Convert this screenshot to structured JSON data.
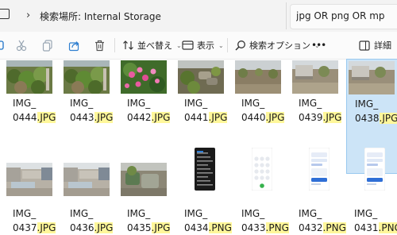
{
  "address_bar": {
    "path": "検索場所: Internal Storage",
    "search_value": "jpg OR png OR mp"
  },
  "toolbar": {
    "sort_label": "並べ替え",
    "view_label": "表示",
    "search_options_label": "検索オプション",
    "more_label": "•••",
    "details_label": "詳細"
  },
  "files": [
    {
      "prefix": "IMG_",
      "number": "0444",
      "ext": ".JPG",
      "thumb": "garden-plants"
    },
    {
      "prefix": "IMG_",
      "number": "0443",
      "ext": ".JPG",
      "thumb": "garden-plants"
    },
    {
      "prefix": "IMG_",
      "number": "0442",
      "ext": ".JPG",
      "thumb": "pink-flowers"
    },
    {
      "prefix": "IMG_",
      "number": "0441",
      "ext": ".JPG",
      "thumb": "rocks-plants"
    },
    {
      "prefix": "IMG_",
      "number": "0440",
      "ext": ".JPG",
      "thumb": "bare-yard"
    },
    {
      "prefix": "IMG_",
      "number": "0439",
      "ext": ".JPG",
      "thumb": "yard-fence"
    },
    {
      "prefix": "IMG_",
      "number": "0438",
      "ext": ".JPG",
      "thumb": "yard-fence"
    },
    {
      "prefix": "IMG_",
      "number": "0437",
      "ext": ".JPG",
      "thumb": "yard-gravel"
    },
    {
      "prefix": "IMG_",
      "number": "0436",
      "ext": ".JPG",
      "thumb": "yard-gravel"
    },
    {
      "prefix": "IMG_",
      "number": "0435",
      "ext": ".JPG",
      "thumb": "plant-pots"
    },
    {
      "prefix": "IMG_",
      "number": "0434",
      "ext": ".PNG",
      "thumb": "phone-dark"
    },
    {
      "prefix": "IMG_",
      "number": "0433",
      "ext": ".PNG",
      "thumb": "phone-dialpad"
    },
    {
      "prefix": "IMG_",
      "number": "0432",
      "ext": ".PNG",
      "thumb": "phone-light"
    },
    {
      "prefix": "IMG_",
      "number": "0431",
      "ext": ".PNG",
      "thumb": "phone-light"
    }
  ],
  "selected_index": 6,
  "colors": {
    "selection": "#cce4f7",
    "extension_highlight": "#fff79a"
  }
}
